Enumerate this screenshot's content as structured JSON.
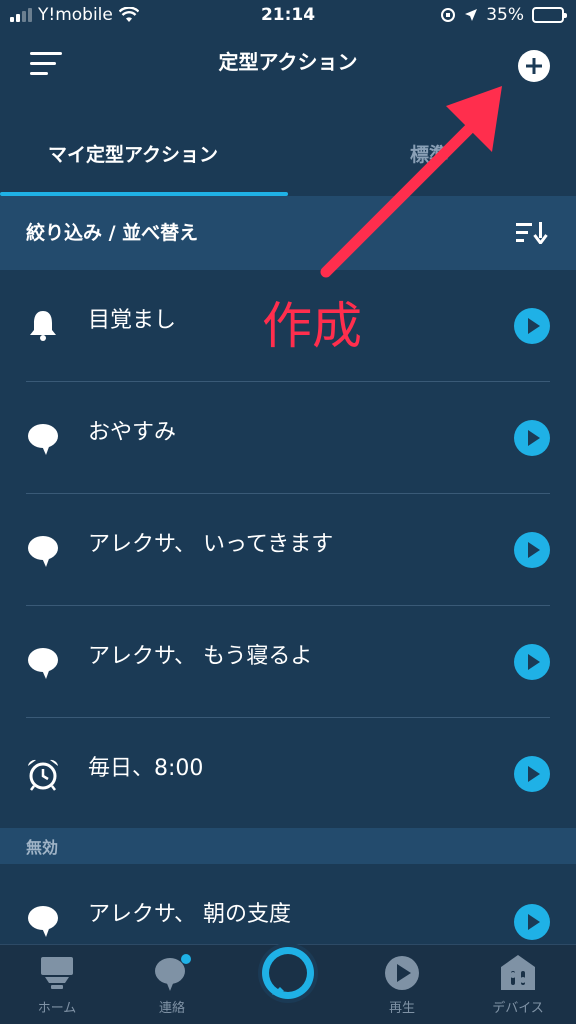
{
  "status_bar": {
    "carrier": "Y!mobile",
    "time": "21:14",
    "battery": "35%",
    "battery_level": 0.35
  },
  "header": {
    "title": "定型アクション"
  },
  "tabs": [
    {
      "label": "マイ定型アクション",
      "active": true
    },
    {
      "label": "標準",
      "active": false
    }
  ],
  "filter": {
    "label": "絞り込み / 並べ替え"
  },
  "routines": [
    {
      "label": "目覚まし",
      "icon": "bell-icon"
    },
    {
      "label": "おやすみ",
      "icon": "speech-bubble-icon"
    },
    {
      "label": "アレクサ、 いってきます",
      "icon": "speech-bubble-icon"
    },
    {
      "label": "アレクサ、 もう寝るよ",
      "icon": "speech-bubble-icon"
    },
    {
      "label": "毎日、8:00",
      "icon": "alarm-clock-icon"
    }
  ],
  "disabled_section": {
    "header": "無効",
    "routines": [
      {
        "label": "アレクサ、 朝の支度",
        "icon": "speech-bubble-icon"
      }
    ]
  },
  "annotation": {
    "text": "作成"
  },
  "bottom_nav": [
    {
      "label": "ホーム",
      "icon": "home-icon"
    },
    {
      "label": "連絡",
      "icon": "chat-icon"
    },
    {
      "label": "",
      "icon": "alexa-icon"
    },
    {
      "label": "再生",
      "icon": "play-icon"
    },
    {
      "label": "デバイス",
      "icon": "devices-icon"
    }
  ],
  "colors": {
    "background": "#1b3a55",
    "accent": "#1fb1e6",
    "annotation": "#ff2e4d"
  }
}
